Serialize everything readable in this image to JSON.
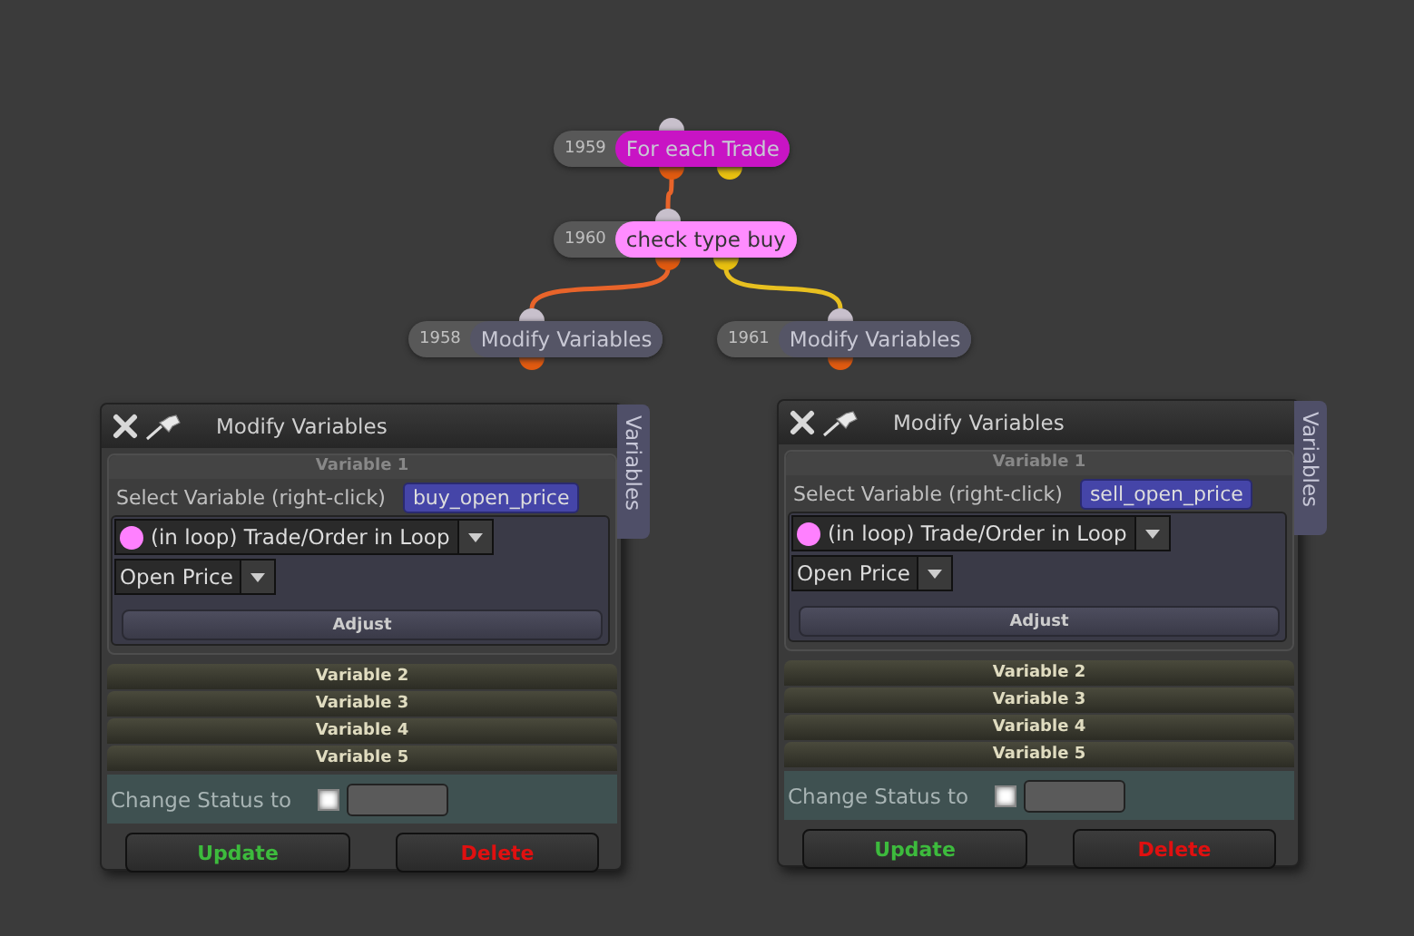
{
  "nodes": [
    {
      "number": "1959",
      "label": "For each Trade",
      "color": "#c814c4"
    },
    {
      "number": "1960",
      "label": "check type buy",
      "color": "#ff8cff"
    },
    {
      "number": "1958",
      "label": "Modify Variables",
      "color": "#555566"
    },
    {
      "number": "1961",
      "label": "Modify Variables",
      "color": "#555566"
    }
  ],
  "edges": [
    {
      "color": "#e8642a"
    },
    {
      "color": "#e8642a"
    },
    {
      "color": "#e8c020"
    }
  ],
  "panels": [
    {
      "title": "Modify Variables",
      "side_tab": "Variables",
      "variable_header": "Variable 1",
      "select_label": "Select Variable (right-click)",
      "variable_name": "buy_open_price",
      "source": {
        "label": "(in loop) Trade/Order in Loop",
        "color": "#ff80ff"
      },
      "field": "Open Price",
      "adjust": "Adjust",
      "sections": [
        "Variable 2",
        "Variable 3",
        "Variable 4",
        "Variable 5"
      ],
      "status_label": "Change Status to",
      "status_checked": false,
      "buttons": [
        {
          "label": "Update",
          "kind": "update"
        },
        {
          "label": "Delete",
          "kind": "delete"
        }
      ]
    },
    {
      "title": "Modify Variables",
      "side_tab": "Variables",
      "variable_header": "Variable 1",
      "select_label": "Select Variable (right-click)",
      "variable_name": "sell_open_price",
      "source": {
        "label": "(in loop) Trade/Order in Loop",
        "color": "#ff80ff"
      },
      "field": "Open Price",
      "adjust": "Adjust",
      "sections": [
        "Variable 2",
        "Variable 3",
        "Variable 4",
        "Variable 5"
      ],
      "status_label": "Change Status to",
      "status_checked": false,
      "buttons": [
        {
          "label": "Update",
          "kind": "update"
        },
        {
          "label": "Delete",
          "kind": "delete"
        }
      ]
    }
  ]
}
